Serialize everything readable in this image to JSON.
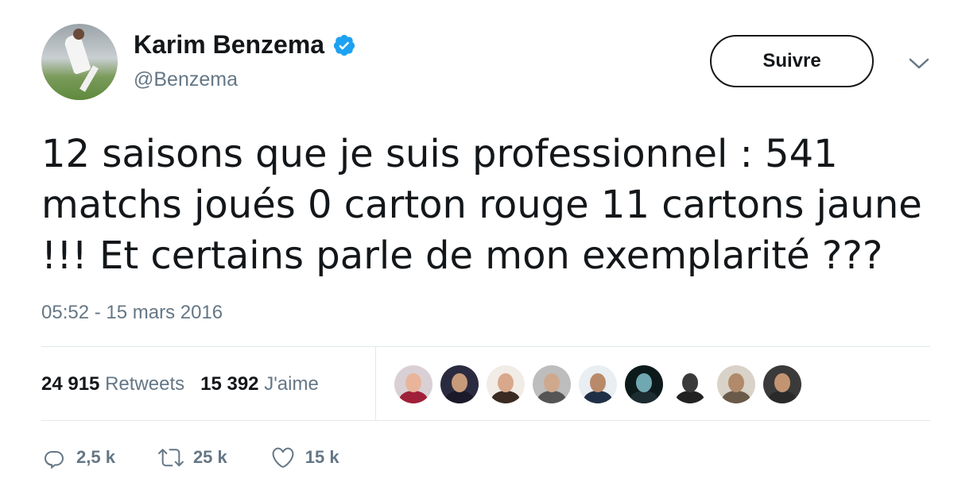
{
  "header": {
    "display_name": "Karim Benzema",
    "handle": "@Benzema",
    "follow_label": "Suivre",
    "verified_color": "#1da1f2"
  },
  "tweet": {
    "text": "12 saisons que je suis professionnel : 541 matchs joués 0 carton rouge 11 cartons jaune !!! Et certains parle de mon exemplarité ???",
    "timestamp": "05:52 - 15 mars 2016"
  },
  "stats": {
    "retweets_count": "24 915",
    "retweets_label": "Retweets",
    "likes_count": "15 392",
    "likes_label": "J'aime"
  },
  "likers": [
    {
      "icon": "liker-avatar",
      "skin": "#e8b59a",
      "body": "#a0203a",
      "bg": "#d9d0d5"
    },
    {
      "icon": "liker-avatar",
      "skin": "#c79a7a",
      "body": "#1a1a2a",
      "bg": "#2a2a40"
    },
    {
      "icon": "liker-avatar",
      "skin": "#d9a88c",
      "body": "#3a2a22",
      "bg": "#f1ece6"
    },
    {
      "icon": "liker-avatar",
      "skin": "#cfa98e",
      "body": "#555555",
      "bg": "#bdbdbd"
    },
    {
      "icon": "liker-avatar",
      "skin": "#b98a6a",
      "body": "#1f2f45",
      "bg": "#e9eef2"
    },
    {
      "icon": "liker-avatar",
      "skin": "#6fa8b0",
      "body": "#1c2c30",
      "bg": "#0d1a1c"
    },
    {
      "icon": "liker-avatar",
      "skin": "#3a3a3a",
      "body": "#222222",
      "bg": "#ffffff"
    },
    {
      "icon": "liker-avatar",
      "skin": "#b08a6a",
      "body": "#6a5a4a",
      "bg": "#d9d2c8"
    },
    {
      "icon": "liker-avatar",
      "skin": "#c29472",
      "body": "#2a2a2a",
      "bg": "#3a3a3a"
    }
  ],
  "actions": {
    "reply_count": "2,5 k",
    "retweet_count": "25 k",
    "like_count": "15 k",
    "icon_color": "#657786"
  }
}
